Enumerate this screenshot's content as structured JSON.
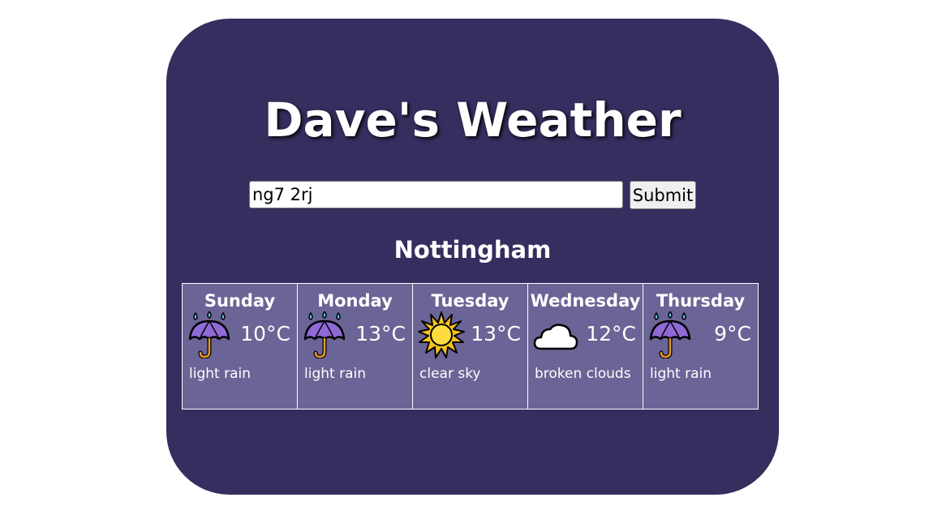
{
  "app": {
    "title": "Dave's Weather"
  },
  "search": {
    "value": "ng7 2rj",
    "submit_label": "Submit"
  },
  "location": {
    "city": "Nottingham"
  },
  "forecast": [
    {
      "day": "Sunday",
      "icon": "umbrella-rain-icon",
      "temp": "10°C",
      "desc": "light rain"
    },
    {
      "day": "Monday",
      "icon": "umbrella-rain-icon",
      "temp": "13°C",
      "desc": "light rain"
    },
    {
      "day": "Tuesday",
      "icon": "sun-icon",
      "temp": "13°C",
      "desc": "clear sky"
    },
    {
      "day": "Wednesday",
      "icon": "cloud-icon",
      "temp": "12°C",
      "desc": "broken clouds"
    },
    {
      "day": "Thursday",
      "icon": "umbrella-rain-icon",
      "temp": "9°C",
      "desc": "light rain"
    }
  ],
  "colors": {
    "card_background": "#372d5f",
    "day_background": "#6b6496",
    "text": "#ffffff"
  }
}
